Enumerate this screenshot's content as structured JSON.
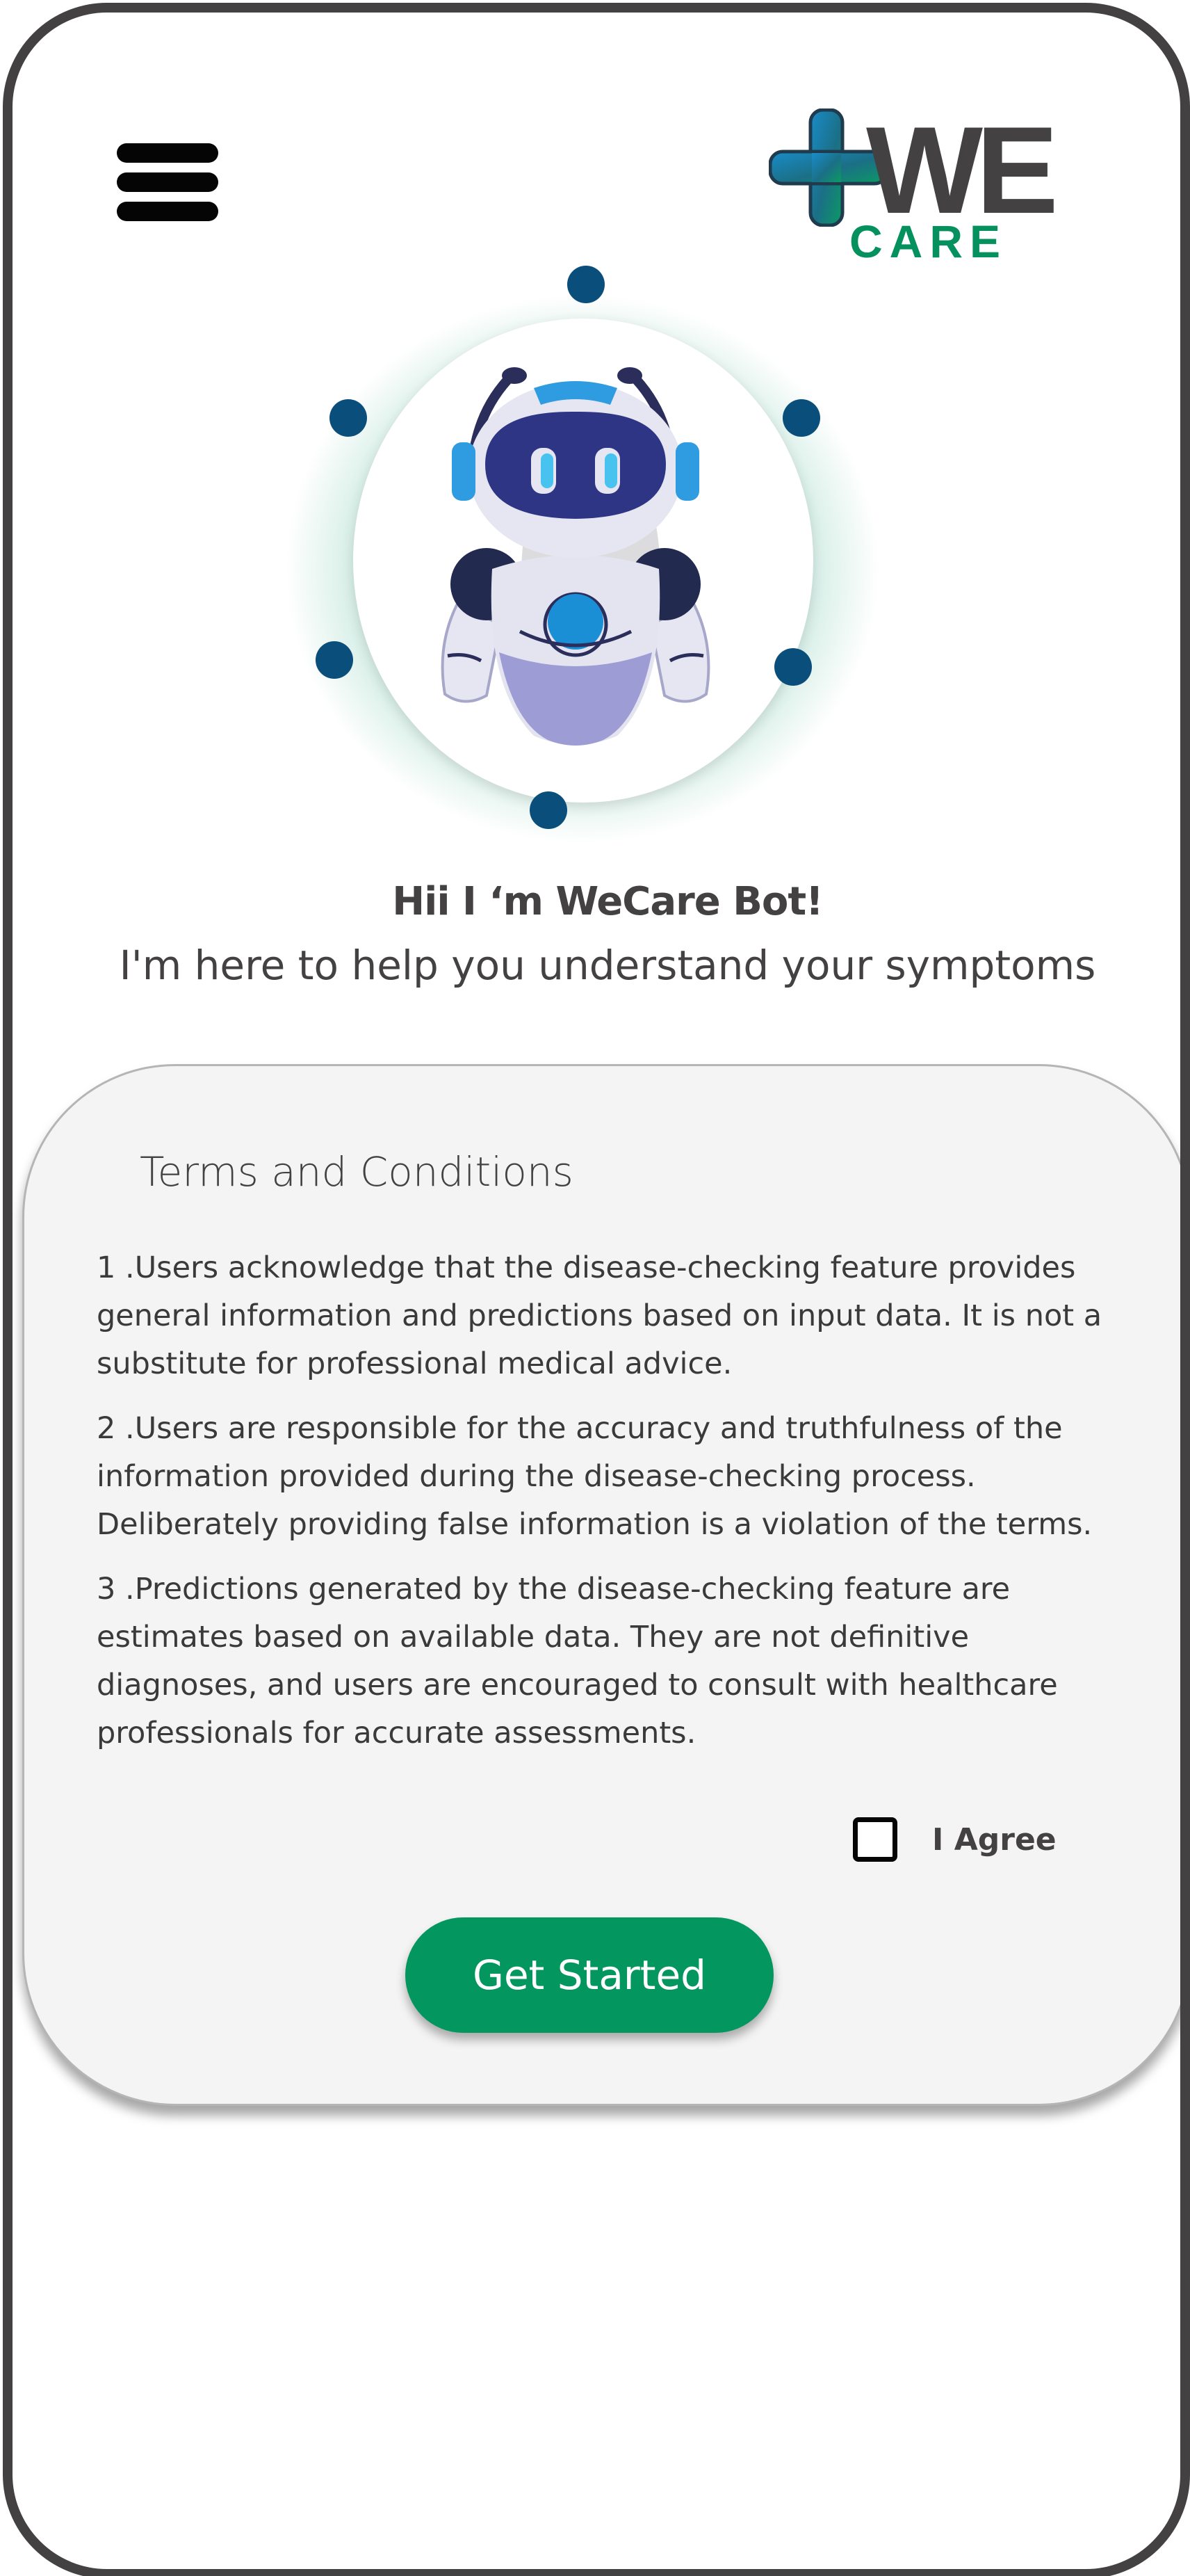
{
  "app": {
    "logo_text_main": "WE",
    "logo_text_sub": "CARE",
    "brand_color": "#04915e",
    "frame_color": "#444142"
  },
  "header": {
    "menu_icon": "hamburger-menu-icon"
  },
  "bot": {
    "avatar_icon": "robot-icon",
    "greeting": "Hii I ‘m WeCare Bot!",
    "subtitle": "I'm here to help you understand your symptoms"
  },
  "terms": {
    "title": "Terms and Conditions",
    "items": [
      "1 .Users acknowledge that the disease-checking feature provides general information and predictions based on input data. It is not a substitute for professional medical advice.",
      "2 .Users are responsible for the accuracy and truthfulness of the information provided during the disease-checking process. Deliberately providing false information is a violation of the terms.",
      "3 .Predictions generated by the disease-checking feature are estimates based on available data. They are not definitive diagnoses, and users are encouraged to consult with healthcare professionals for accurate assessments."
    ],
    "agree_label": "I Agree",
    "agree_checked": false,
    "button_label": "Get Started",
    "button_color": "#04965f"
  }
}
